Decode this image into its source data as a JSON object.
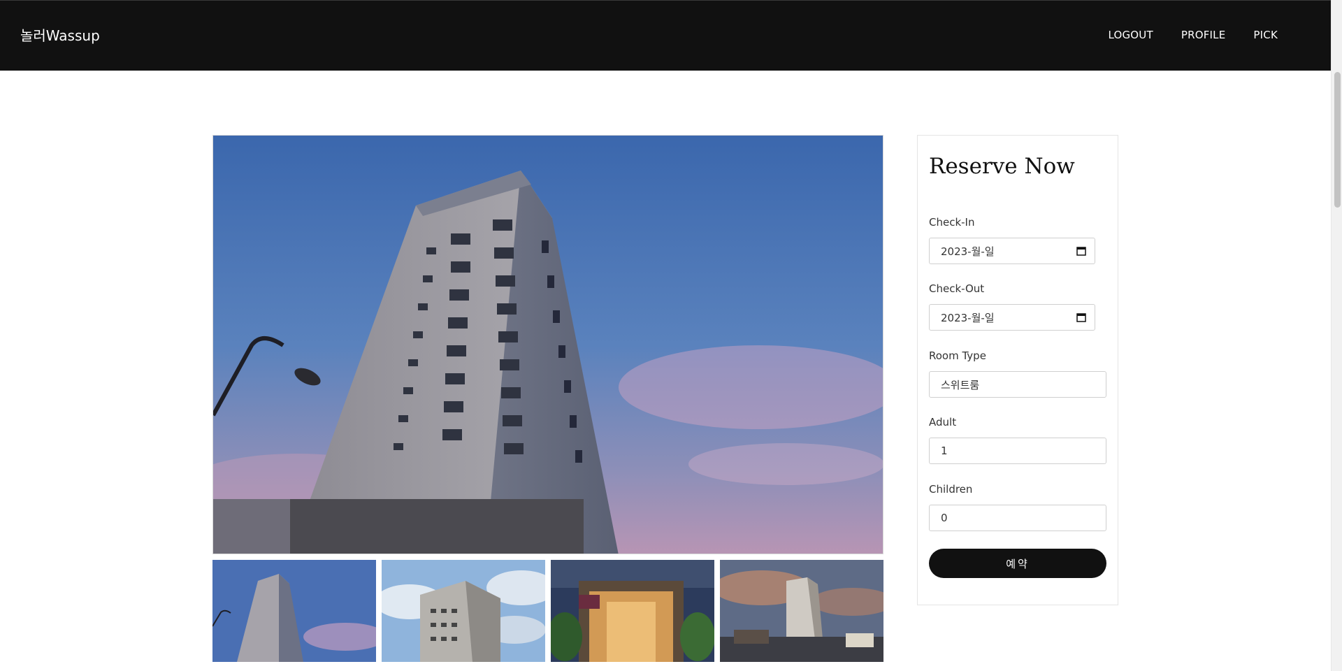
{
  "navbar": {
    "brand": "놀러Wassup",
    "links": [
      "LOGOUT",
      "PROFILE",
      "PICK"
    ]
  },
  "reserve": {
    "title": "Reserve Now",
    "check_in_label": "Check-In",
    "check_in_value": "2023-월-일",
    "check_out_label": "Check-Out",
    "check_out_value": "2023-월-일",
    "room_type_label": "Room Type",
    "room_type_value": "스위트룸",
    "adult_label": "Adult",
    "adult_value": "1",
    "children_label": "Children",
    "children_value": "0",
    "submit_label": "예약"
  },
  "colors": {
    "navbar_bg": "#111111",
    "button_bg": "#111111",
    "sky_top": "#3f6db5",
    "sky_bottom": "#c99ab5"
  }
}
